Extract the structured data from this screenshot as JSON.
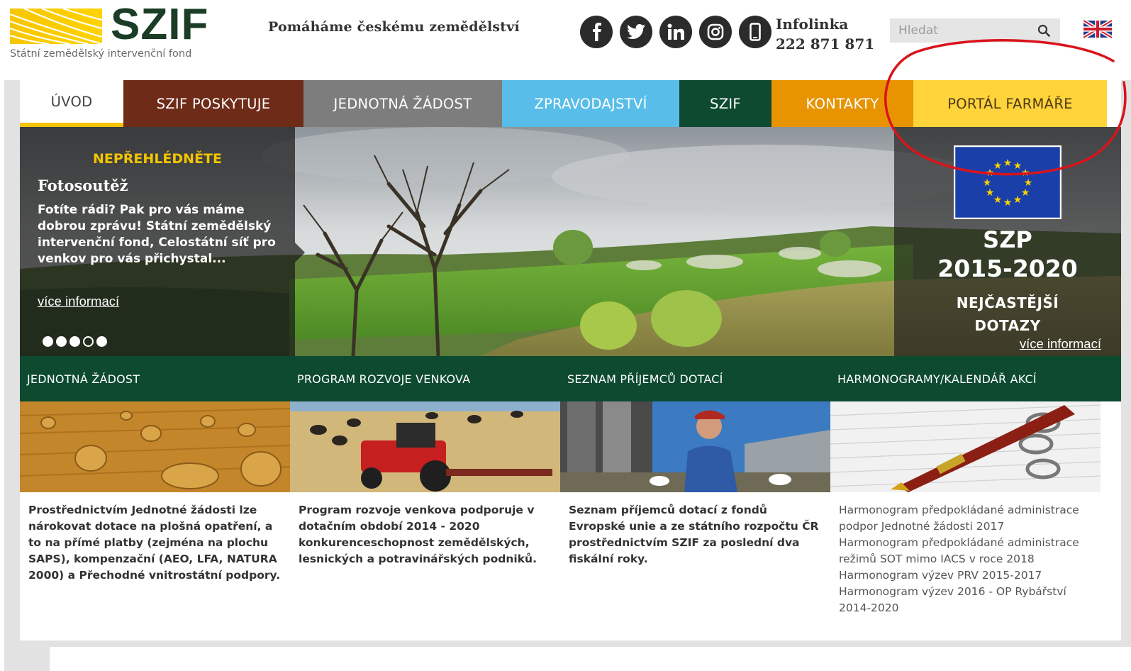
{
  "header": {
    "logo_text": "SZIF",
    "logo_subtitle": "Státní zemědělský intervenční fond",
    "tagline": "Pomáháme českému zemědělství",
    "social": [
      "facebook-icon",
      "twitter-icon",
      "linkedin-icon",
      "instagram-icon",
      "mobile-icon"
    ],
    "hotline_label": "Infolinka",
    "hotline_number": "222 871 871",
    "search_placeholder": "Hledat",
    "language_flag": "uk-flag-icon"
  },
  "nav": [
    {
      "label": "ÚVOD",
      "color": "#ffffff"
    },
    {
      "label": "SZIF POSKYTUJE",
      "color": "#6e2b17"
    },
    {
      "label": "JEDNOTNÁ ŽÁDOST",
      "color": "#7d7d7d"
    },
    {
      "label": "ZPRAVODAJSTVÍ",
      "color": "#58bde8"
    },
    {
      "label": "SZIF",
      "color": "#0d4a30"
    },
    {
      "label": "KONTAKTY",
      "color": "#e79400"
    },
    {
      "label": "PORTÁL FARMÁŘE",
      "color": "#ffd33a"
    }
  ],
  "hero": {
    "news_kicker": "NEPŘEHLÉDNĚTE",
    "news_title": "Fotosoutěž",
    "news_text": "Fotíte rádi? Pak pro vás máme dobrou zprávu! Státní zemědělský intervenční fond, Celostátní síť pro venkov pro vás přichystal...",
    "news_more": "více informací",
    "slide_count": 5,
    "active_slide": 4,
    "szp_title": "SZP",
    "szp_years": "2015-2020",
    "szp_sub_1": "NEJČASTĚJŠÍ",
    "szp_sub_2": "DOTAZY",
    "szp_more": "více informací"
  },
  "tiles": [
    {
      "title": "JEDNOTNÁ ŽÁDOST",
      "text": "Prostřednictvím Jednotné žádosti lze nárokovat dotace na plošná opatření, a to na přímé platby (zejména na plochu SAPS), kompenzační (AEO, LFA, NATURA 2000) a Přechodné vnitrostátní podpory."
    },
    {
      "title": "PROGRAM ROZVOJE VENKOVA",
      "text": "Program rozvoje venkova podporuje v dotačním období 2014 - 2020 konkurenceschopnost zemědělských, lesnických a potravinářských podniků."
    },
    {
      "title": "SEZNAM PŘÍJEMCŮ DOTACÍ",
      "text": "Seznam příjemců dotací z fondů Evropské unie a ze státního rozpočtu ČR prostřednictvím SZIF za poslední dva fiskální roky."
    },
    {
      "title": "HARMONOGRAMY/KALENDÁŘ AKCÍ",
      "links": [
        "Harmonogram předpokládané administrace podpor Jednotné žádosti 2017",
        "Harmonogram předpokládané administrace režimů SOT mimo IACS v roce 2018",
        "Harmonogram výzev PRV 2015-2017",
        "Harmonogram výzev 2016 - OP Rybářství 2014-2020"
      ]
    }
  ],
  "colors": {
    "brand_green": "#0d4a30",
    "brand_yellow": "#f4c400",
    "annotation_red": "#d9141b"
  }
}
